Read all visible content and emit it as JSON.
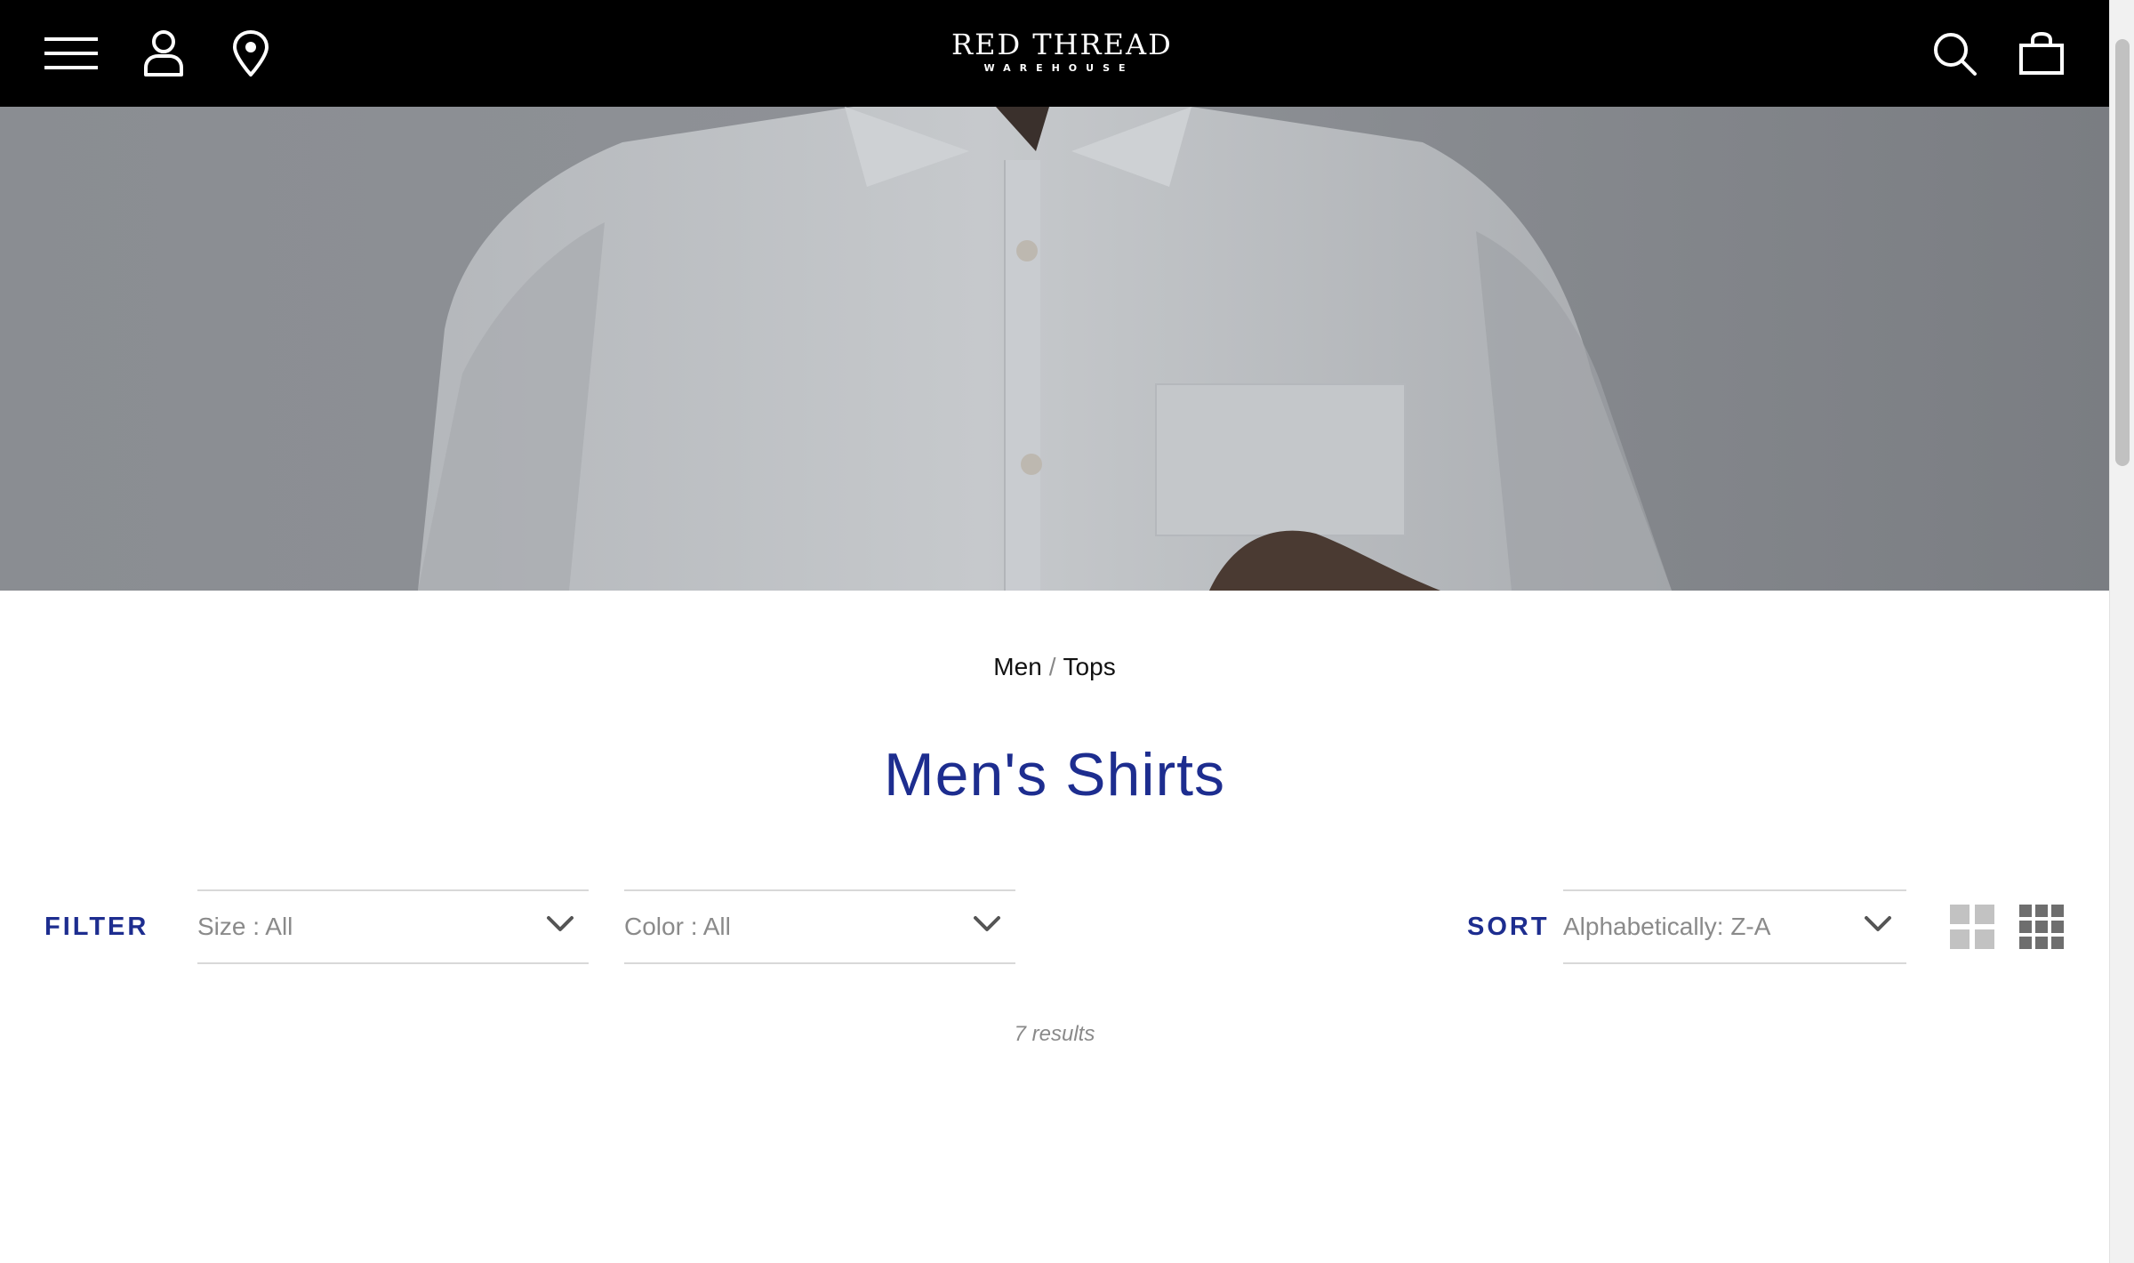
{
  "header": {
    "logo": {
      "main": "RED THREAD",
      "sub": "WAREHOUSE"
    },
    "icons": {
      "menu": "hamburger-menu-icon",
      "account": "user-icon",
      "location": "location-pin-icon",
      "search": "search-icon",
      "cart": "shopping-bag-icon"
    }
  },
  "hero": {
    "description_icon": "shirt-photo"
  },
  "breadcrumb": {
    "items": [
      "Men",
      "Tops"
    ],
    "separator": "/"
  },
  "page_title": "Men's Shirts",
  "filter": {
    "label": "FILTER",
    "size_select": "Size : All",
    "color_select": "Color : All"
  },
  "sort": {
    "label": "SORT",
    "selected": "Alphabetically: Z-A"
  },
  "view_toggle": {
    "two_column": "grid-2x2-icon",
    "three_column": "grid-3x3-icon"
  },
  "results_text": "7 results",
  "colors": {
    "header_bg": "#000000",
    "accent_blue": "#1d2d8f",
    "muted_text": "#8a8a8a",
    "divider": "#d8d8d8"
  }
}
